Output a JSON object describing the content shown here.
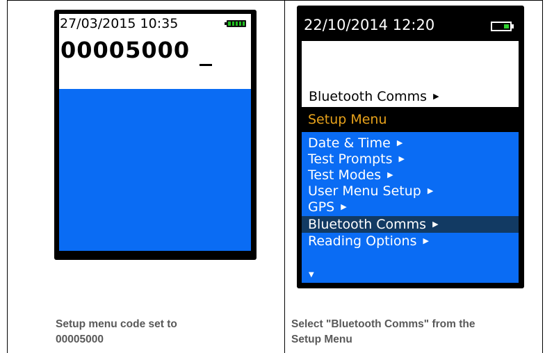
{
  "left_panel": {
    "device": {
      "datetime": "27/03/2015 10:35",
      "code_value": "00005000",
      "battery_icon": "battery-full-icon",
      "battery_color": "#1fbf1f",
      "screen_blue": "#0a6cf4"
    },
    "caption_line1": "Setup menu code set to",
    "caption_line2": "00005000"
  },
  "right_panel": {
    "device": {
      "datetime": "22/10/2014 12:20",
      "battery_icon": "battery-low-icon",
      "current_item": "Bluetooth Comms",
      "menu_title": "Setup Menu",
      "menu_title_color": "#e8a21b",
      "menu_items": [
        {
          "label": "Date & Time",
          "selected": false
        },
        {
          "label": "Test Prompts",
          "selected": false
        },
        {
          "label": "Test Modes",
          "selected": false
        },
        {
          "label": "User Menu Setup",
          "selected": false
        },
        {
          "label": "GPS",
          "selected": false
        },
        {
          "label": "Bluetooth Comms",
          "selected": true
        },
        {
          "label": "Reading Options",
          "selected": false
        }
      ],
      "more_indicator_icon": "scroll-down-icon",
      "selected_color": "#123a63"
    },
    "caption_line1": "Select \"Bluetooth Comms\" from the",
    "caption_line2": "Setup Menu"
  }
}
